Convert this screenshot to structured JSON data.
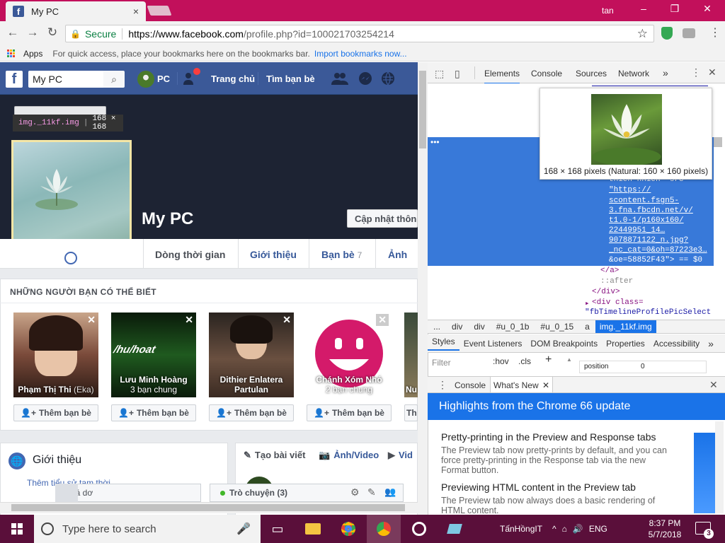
{
  "browser": {
    "tab_title": "My PC",
    "tab_close": "×",
    "profile_name": "tan",
    "win_min": "–",
    "win_max": "❐",
    "win_close": "✕",
    "back": "←",
    "forward": "→",
    "reload": "↻",
    "secure_label": "Secure",
    "url_host": "https://www.facebook.com",
    "url_path": "/profile.php?id=100021703254214",
    "star": "☆",
    "bookmarks_apps": "Apps",
    "bookmarks_hint": "For quick access, place your bookmarks here on the bookmarks bar.",
    "bookmarks_import": "Import bookmarks now..."
  },
  "facebook": {
    "logo": "f",
    "search_value": "My PC",
    "search_icon": "search-icon",
    "nav_user": "PC",
    "nav_home": "Trang chủ",
    "nav_find_friends": "Tìm bạn bè",
    "profile_name": "My PC",
    "update_info": "Cập nhật thông",
    "tooltip_selector": "img._11kf.img",
    "tooltip_dims": "168 × 168",
    "tabs": [
      {
        "label": "Dòng thời gian"
      },
      {
        "label": "Giới thiệu"
      },
      {
        "label": "Bạn bè",
        "count": "7"
      },
      {
        "label": "Ảnh"
      }
    ],
    "pymk_title": "NHỮNG NGƯỜI BẠN CÓ THỂ BIẾT",
    "pymk_cards": [
      {
        "name": "Phạm Thị Thi",
        "extra": "(Eka)",
        "mutual": "",
        "add": "Thêm bạn bè"
      },
      {
        "name": "Lưu Minh Hoàng",
        "extra": "",
        "mutual": "3 bạn chung",
        "add": "Thêm bạn bè"
      },
      {
        "name": "Dithier Enlatera",
        "extra": "Partulan",
        "mutual": "",
        "add": "Thêm bạn bè"
      },
      {
        "name": "Chánh Xóm Nhỏ",
        "extra": "",
        "mutual": "2 bạn chung",
        "add": "Thêm bạn bè"
      },
      {
        "name": "Nu",
        "extra": "",
        "mutual": "",
        "add": "Th"
      }
    ],
    "intro_title": "Giới thiệu",
    "intro_sub": "Thêm tiểu sử tạm thời",
    "composer_post": "Tạo bài viết",
    "composer_photo": "Ảnh/Video",
    "composer_video": "Vid",
    "chat_left": "bá dơ",
    "chat_right": "Trò chuyện (3)"
  },
  "devtools": {
    "tabs": [
      "Elements",
      "Console",
      "Sources",
      "Network"
    ],
    "more": "»",
    "img_caption": "168 × 168 pixels (Natural: 160 × 160 pixels)",
    "tree_lines": [
      "thien nhien\" src=",
      "\"https://",
      "scontent.fsgn5-",
      "3.fna.fbcdn.net/v/",
      "t1.0-1/p160x160/",
      "22449951_14…",
      "9078871122_n.jpg?",
      "_nc_cat=0&oh=87223e3…",
      "&oe=58852F43\"> == $0"
    ],
    "tree_after": [
      "</a>",
      "::after",
      "</div>",
      "<div class=",
      "\"fbTimelineProfilePicSelect"
    ],
    "crumbs": [
      "...",
      "div",
      "div",
      "#u_0_1b",
      "#u_0_15",
      "a",
      "img._11kf.img"
    ],
    "style_tabs": [
      "Styles",
      "Event Listeners",
      "DOM Breakpoints",
      "Properties",
      "Accessibility"
    ],
    "filter_placeholder": "Filter",
    "hov": ":hov",
    "cls": ".cls",
    "position_key": "position",
    "position_val": "0",
    "drawer_tabs": [
      "Console",
      "What's New"
    ],
    "whatsnew_title": "Highlights from the Chrome 66 update",
    "items": [
      {
        "h": "Pretty-printing in the Preview and Response tabs",
        "p": "The Preview tab now pretty-prints by default, and you can force pretty-printing in the Response tab via the new Format button."
      },
      {
        "h": "Previewing HTML content in the Preview tab",
        "p": "The Preview tab now always does a basic rendering of HTML content."
      }
    ]
  },
  "taskbar": {
    "search_placeholder": "Type here to search",
    "user": "TấnHồngIT",
    "lang": "ENG",
    "time": "8:37 PM",
    "date": "5/7/2018",
    "notif_count": "3"
  },
  "colors": {
    "chrome_accent": "#c2105b",
    "facebook_blue": "#3b5998",
    "devtools_select": "#3879d9"
  }
}
